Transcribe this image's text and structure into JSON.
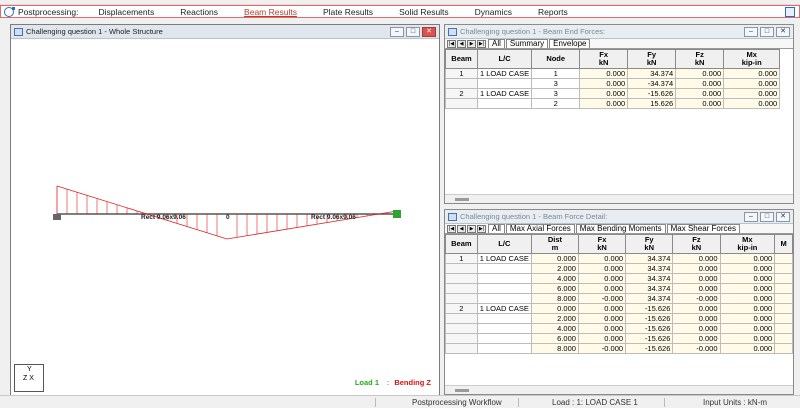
{
  "toolbar": {
    "title": "Postprocessing:",
    "tabs": [
      "Displacements",
      "Reactions",
      "Beam Results",
      "Plate Results",
      "Solid Results",
      "Dynamics",
      "Reports"
    ],
    "active_tab": "Beam Results"
  },
  "whole_structure": {
    "title": "Challenging question 1 - Whole Structure",
    "labels": {
      "section_left": "Rect 9.06x9.06",
      "section_right": "Rect 9.06x9.06",
      "zero": "0"
    },
    "axis": {
      "y": "Y",
      "zx": "Z  X"
    },
    "legend": {
      "load": "Load 1",
      "sep": ":",
      "bending": "Bending Z"
    },
    "colors": {
      "diagram": "#e02020",
      "beam": "#555555",
      "load_text": "#1eae1e",
      "bending_text": "#d11111"
    }
  },
  "end_forces": {
    "title": "Challenging question 1 - Beam End Forces:",
    "tabs": [
      "All",
      "Summary",
      "Envelope"
    ],
    "columns": [
      {
        "label": "Beam",
        "unit": ""
      },
      {
        "label": "L/C",
        "unit": ""
      },
      {
        "label": "Node",
        "unit": ""
      },
      {
        "label": "Fx",
        "unit": "kN"
      },
      {
        "label": "Fy",
        "unit": "kN"
      },
      {
        "label": "Fz",
        "unit": "kN"
      },
      {
        "label": "Mx",
        "unit": "kip-in"
      }
    ],
    "rows": [
      {
        "beam": "1",
        "lc": "1 LOAD CASE",
        "node": "1",
        "fx": "0.000",
        "fy": "34.374",
        "fz": "0.000",
        "mx": "0.000"
      },
      {
        "beam": "",
        "lc": "",
        "node": "3",
        "fx": "0.000",
        "fy": "-34.374",
        "fz": "0.000",
        "mx": "0.000"
      },
      {
        "beam": "2",
        "lc": "1 LOAD CASE",
        "node": "3",
        "fx": "0.000",
        "fy": "-15.626",
        "fz": "0.000",
        "mx": "0.000"
      },
      {
        "beam": "",
        "lc": "",
        "node": "2",
        "fx": "0.000",
        "fy": "15.626",
        "fz": "0.000",
        "mx": "0.000"
      }
    ]
  },
  "force_detail": {
    "title": "Challenging question 1 - Beam Force Detail:",
    "tabs": [
      "All",
      "Max Axial Forces",
      "Max Bending Moments",
      "Max Shear Forces"
    ],
    "columns": [
      {
        "label": "Beam",
        "unit": ""
      },
      {
        "label": "L/C",
        "unit": ""
      },
      {
        "label": "Dist",
        "unit": "m"
      },
      {
        "label": "Fx",
        "unit": "kN"
      },
      {
        "label": "Fy",
        "unit": "kN"
      },
      {
        "label": "Fz",
        "unit": "kN"
      },
      {
        "label": "Mx",
        "unit": "kip-in"
      },
      {
        "label": "M",
        "unit": ""
      }
    ],
    "rows": [
      {
        "beam": "1",
        "lc": "1 LOAD CASE",
        "dist": "0.000",
        "fx": "0.000",
        "fy": "34.374",
        "fz": "0.000",
        "mx": "0.000"
      },
      {
        "beam": "",
        "lc": "",
        "dist": "2.000",
        "fx": "0.000",
        "fy": "34.374",
        "fz": "0.000",
        "mx": "0.000"
      },
      {
        "beam": "",
        "lc": "",
        "dist": "4.000",
        "fx": "0.000",
        "fy": "34.374",
        "fz": "0.000",
        "mx": "0.000"
      },
      {
        "beam": "",
        "lc": "",
        "dist": "6.000",
        "fx": "0.000",
        "fy": "34.374",
        "fz": "0.000",
        "mx": "0.000"
      },
      {
        "beam": "",
        "lc": "",
        "dist": "8.000",
        "fx": "-0.000",
        "fy": "34.374",
        "fz": "-0.000",
        "mx": "0.000"
      },
      {
        "beam": "2",
        "lc": "1 LOAD CASE",
        "dist": "0.000",
        "fx": "0.000",
        "fy": "-15.626",
        "fz": "0.000",
        "mx": "0.000"
      },
      {
        "beam": "",
        "lc": "",
        "dist": "2.000",
        "fx": "0.000",
        "fy": "-15.626",
        "fz": "0.000",
        "mx": "0.000"
      },
      {
        "beam": "",
        "lc": "",
        "dist": "4.000",
        "fx": "0.000",
        "fy": "-15.626",
        "fz": "0.000",
        "mx": "0.000"
      },
      {
        "beam": "",
        "lc": "",
        "dist": "6.000",
        "fx": "0.000",
        "fy": "-15.626",
        "fz": "0.000",
        "mx": "0.000"
      },
      {
        "beam": "",
        "lc": "",
        "dist": "8.000",
        "fx": "-0.000",
        "fy": "-15.626",
        "fz": "-0.000",
        "mx": "0.000"
      }
    ]
  },
  "statusbar": {
    "workflow": "Postprocessing Workflow",
    "load": "Load : 1: LOAD CASE 1",
    "units": "Input Units : kN-m"
  }
}
